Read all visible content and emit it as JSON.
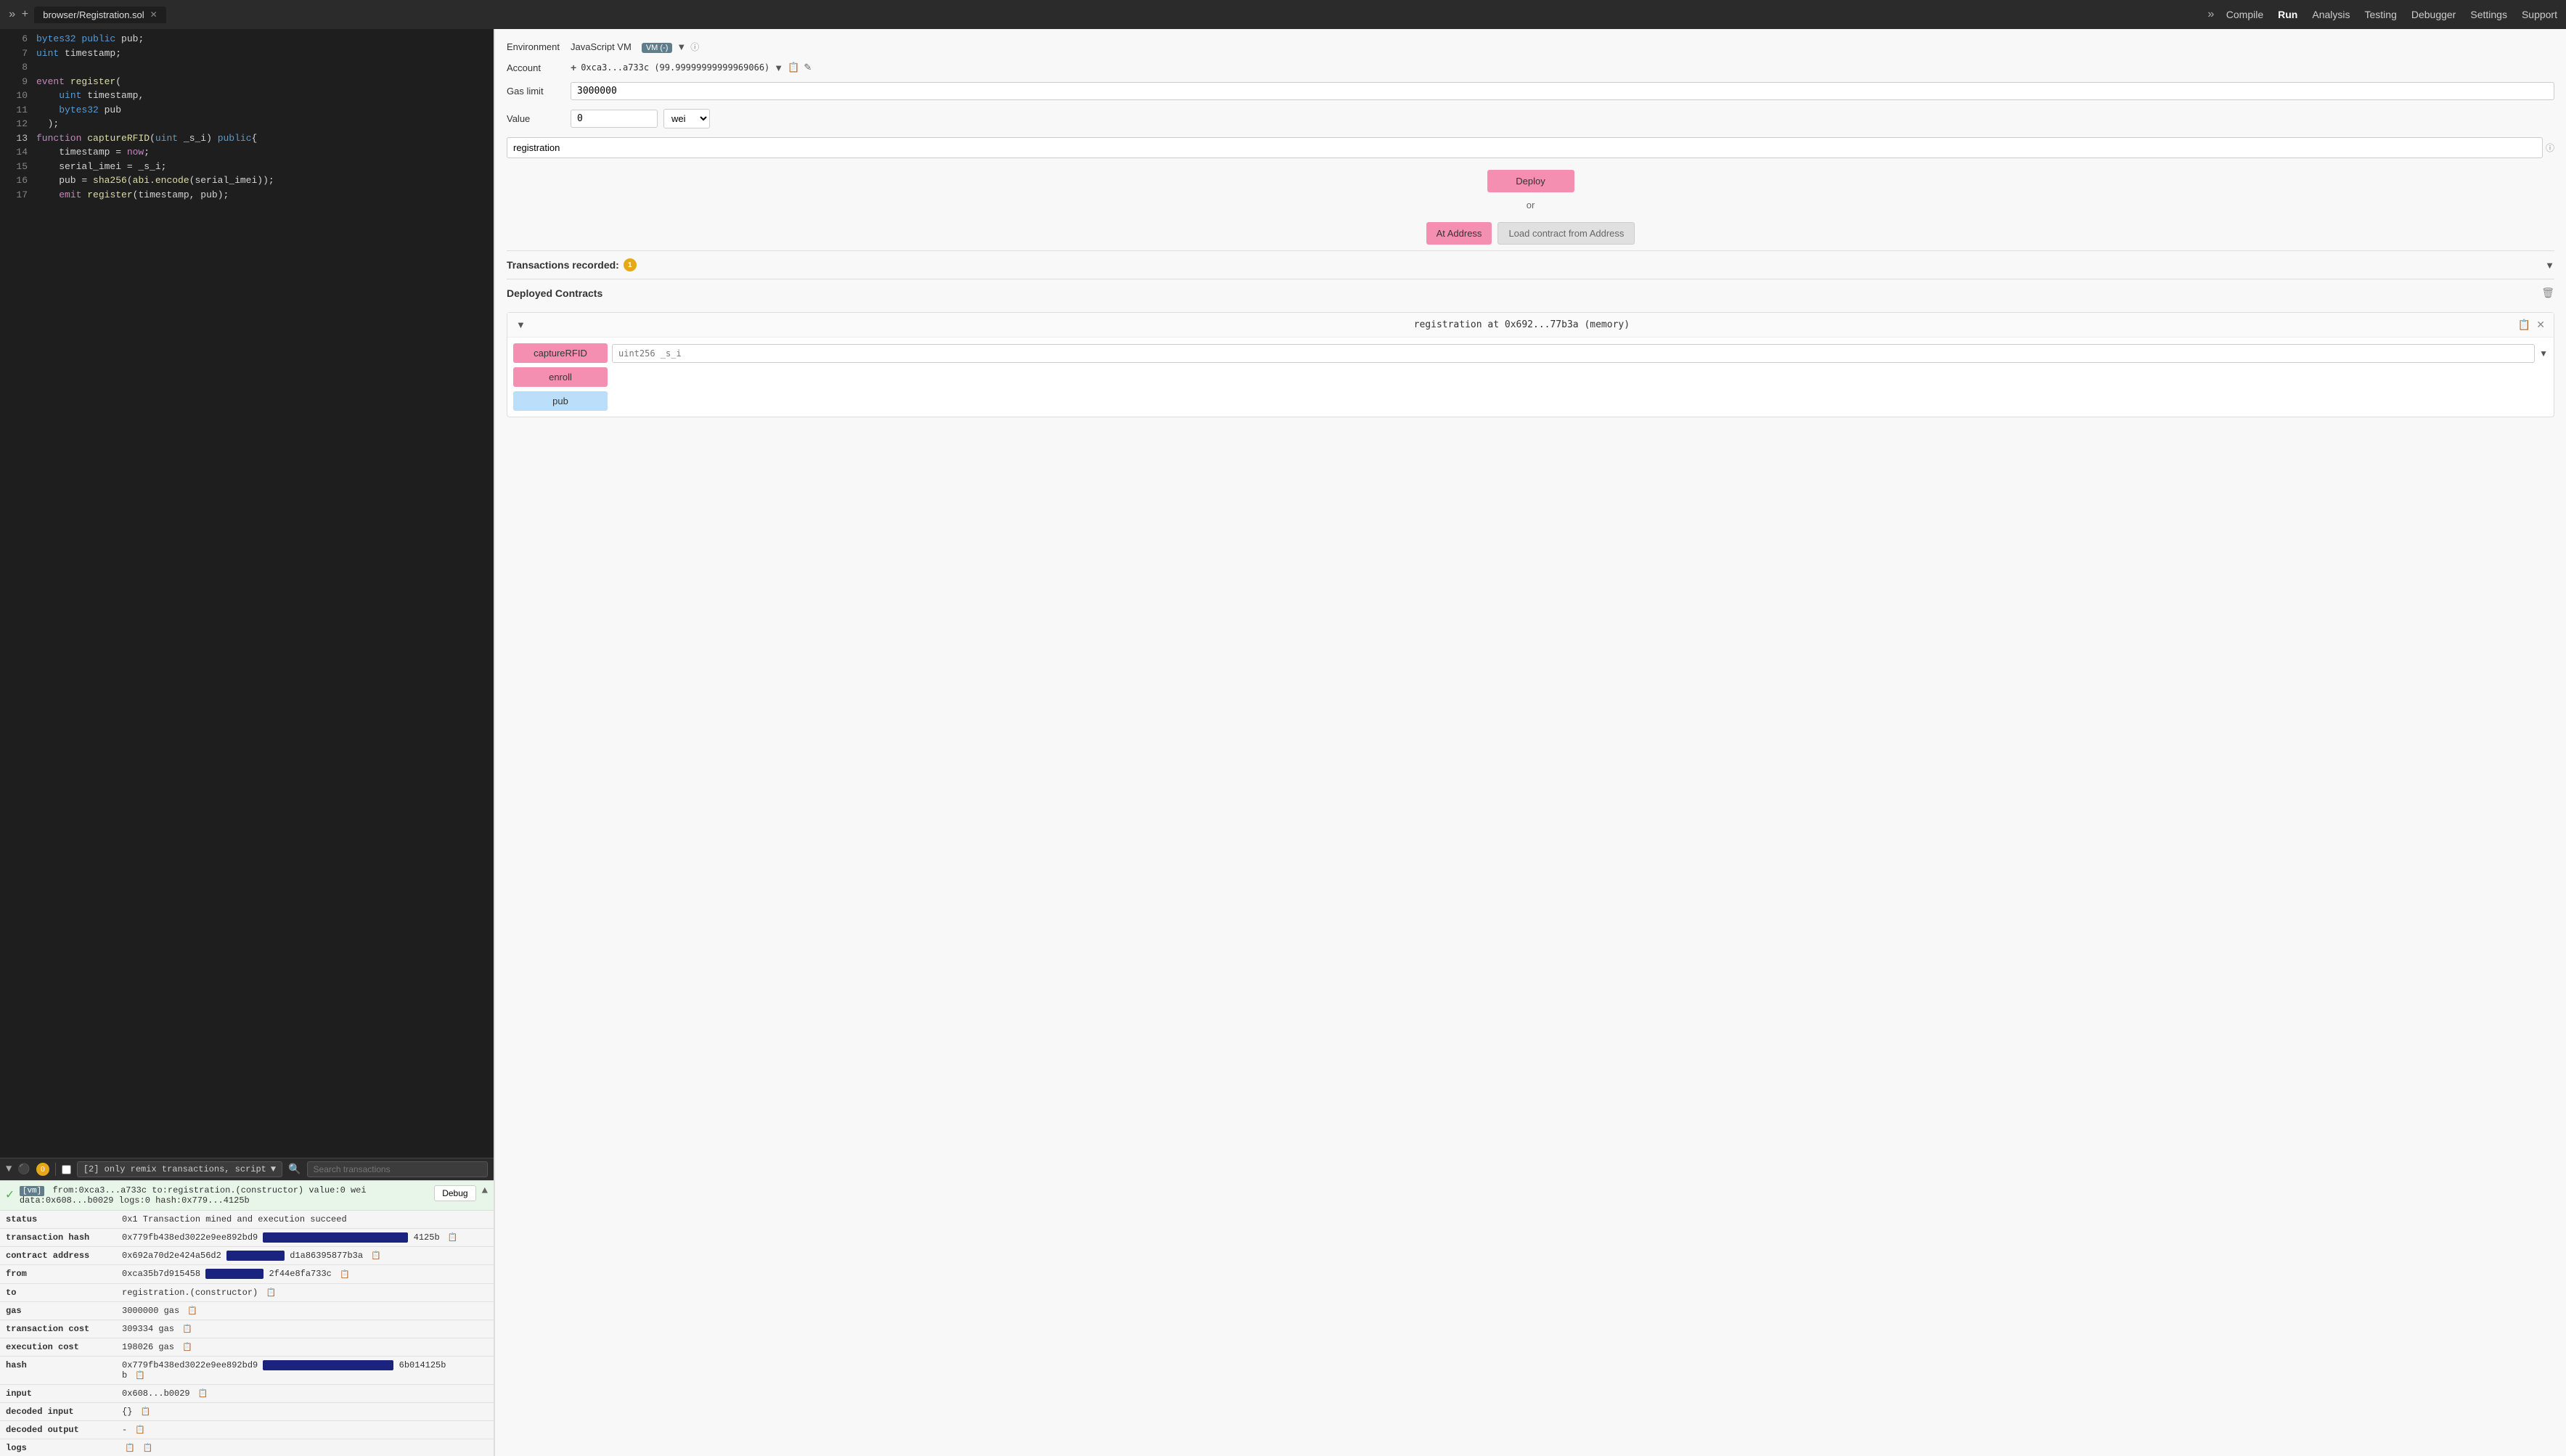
{
  "topnav": {
    "title": "browser/Registration.sol",
    "nav_items": [
      "Compile",
      "Run",
      "Analysis",
      "Testing",
      "Debugger",
      "Settings",
      "Support"
    ],
    "active_nav": "Run"
  },
  "editor": {
    "lines": [
      {
        "num": 6,
        "tokens": [
          {
            "t": "kw",
            "v": "bytes32"
          },
          {
            "t": "op",
            "v": " public pub;"
          }
        ]
      },
      {
        "num": 7,
        "tokens": [
          {
            "t": "kw",
            "v": "uint"
          },
          {
            "t": "op",
            "v": " timestamp;"
          }
        ]
      },
      {
        "num": 8,
        "tokens": [
          {
            "t": "op",
            "v": ""
          }
        ]
      },
      {
        "num": 9,
        "tokens": [
          {
            "t": "kw2",
            "v": "event"
          },
          {
            "t": "op",
            "v": " "
          },
          {
            "t": "fn",
            "v": "register"
          },
          {
            "t": "op",
            "v": "("
          }
        ]
      },
      {
        "num": 10,
        "tokens": [
          {
            "t": "op",
            "v": "        "
          },
          {
            "t": "kw",
            "v": "uint"
          },
          {
            "t": "op",
            "v": " timestamp,"
          }
        ]
      },
      {
        "num": 11,
        "tokens": [
          {
            "t": "op",
            "v": "        "
          },
          {
            "t": "kw",
            "v": "bytes32"
          },
          {
            "t": "op",
            "v": " pub"
          }
        ]
      },
      {
        "num": 12,
        "tokens": [
          {
            "t": "op",
            "v": "    );"
          }
        ]
      },
      {
        "num": 13,
        "tokens": [
          {
            "t": "kw2",
            "v": "function"
          },
          {
            "t": "op",
            "v": " "
          },
          {
            "t": "fn",
            "v": "captureRFID"
          },
          {
            "t": "op",
            "v": "("
          },
          {
            "t": "kw",
            "v": "uint"
          },
          {
            "t": "op",
            "v": " _s_i) "
          },
          {
            "t": "kw",
            "v": "public"
          },
          {
            "t": "op",
            "v": "{"
          }
        ]
      },
      {
        "num": 14,
        "tokens": [
          {
            "t": "op",
            "v": "        timestamp = "
          },
          {
            "t": "kw2",
            "v": "now"
          },
          {
            "t": "op",
            "v": ";"
          }
        ]
      },
      {
        "num": 15,
        "tokens": [
          {
            "t": "op",
            "v": "        serial_imei = _s_i;"
          }
        ]
      },
      {
        "num": 16,
        "tokens": [
          {
            "t": "op",
            "v": "        pub = "
          },
          {
            "t": "fn",
            "v": "sha256"
          },
          {
            "t": "op",
            "v": "("
          },
          {
            "t": "fn",
            "v": "abi.encode"
          },
          {
            "t": "op",
            "v": "(serial_imei));"
          }
        ]
      },
      {
        "num": 17,
        "tokens": [
          {
            "t": "op",
            "v": "        "
          },
          {
            "t": "kw2",
            "v": "emit"
          },
          {
            "t": "op",
            "v": " "
          },
          {
            "t": "fn",
            "v": "register"
          },
          {
            "t": "op",
            "v": "(timestamp, pub);"
          }
        ]
      }
    ]
  },
  "bottom_toolbar": {
    "filter_label": "[2] only remix transactions, script",
    "search_placeholder": "Search transactions"
  },
  "log": {
    "from": "0xca3...a733c",
    "to": "registration.(constructor)",
    "value": "0 wei",
    "data": "0x608...b0029",
    "logs": "0",
    "hash": "0x779...4125b",
    "debug_label": "Debug",
    "status": "0x1 Transaction mined and execution succeed",
    "tx_hash_full": "0x779fb438ed3022e9ee892bd9",
    "tx_hash_end": "4125b",
    "contract_address": "0x692a70d2e424a56d2",
    "contract_address_end": "d1a86395877b3a",
    "from_addr": "0xca35b7d915458",
    "from_addr_end": "2f44e8fa733c",
    "to_val": "registration.(constructor)",
    "gas_val": "3000000 gas",
    "transaction_cost": "309334 gas",
    "execution_cost": "198026 gas",
    "hash_full2": "0x779fb438ed3022e9ee892bd9",
    "hash_end2": "6b014125b",
    "input_val": "0x608...b0029",
    "decoded_input": "{}",
    "decoded_output": "-",
    "logs_val": ""
  },
  "right_panel": {
    "environment_label": "Environment",
    "environment_value": "JavaScript VM",
    "vm_label": "VM (-)",
    "account_label": "Account",
    "account_value": "0xca3...a733c (99.99999999999969066)",
    "gas_limit_label": "Gas limit",
    "gas_limit_value": "3000000",
    "value_label": "Value",
    "value_amount": "0",
    "value_unit": "wei",
    "contract_select_value": "registration",
    "deploy_label": "Deploy",
    "or_text": "or",
    "at_address_label": "At Address",
    "load_contract_label": "Load contract from Address",
    "transactions_recorded_label": "Transactions recorded:",
    "transactions_count": "1",
    "deployed_contracts_label": "Deployed Contracts",
    "instance_name": "registration at 0x692...77b3a (memory)",
    "fn_capture_label": "captureRFID",
    "fn_capture_param": "uint256 _s_i",
    "fn_enroll_label": "enroll",
    "fn_pub_label": "pub"
  }
}
